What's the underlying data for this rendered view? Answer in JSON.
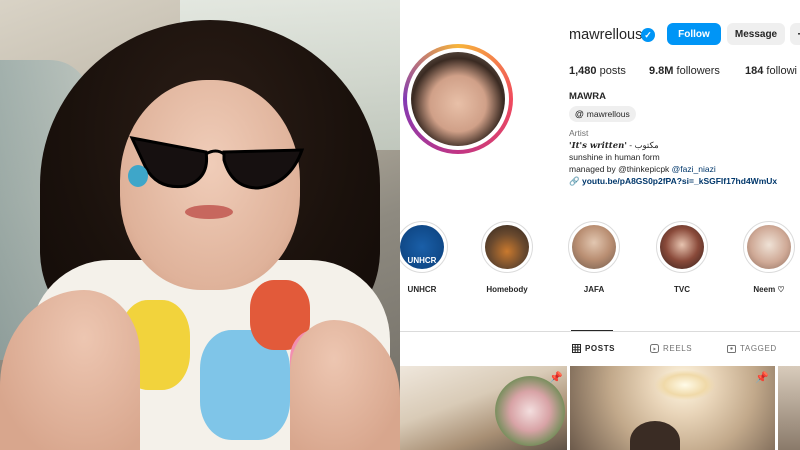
{
  "profile": {
    "username": "mawrellous",
    "follow_label": "Follow",
    "message_label": "Message",
    "more_label": "+",
    "stats": {
      "posts_count": "1,480",
      "posts_label": "posts",
      "followers_count": "9.8M",
      "followers_label": "followers",
      "following_count": "184",
      "following_label": "followi"
    },
    "display_name": "MAWRA",
    "threads_handle": "mawrellous",
    "category": "Artist",
    "bio_line1_italic": "'It's written'",
    "bio_line1_rest": " - مكتوب",
    "bio_line2": "sunshine in human form",
    "bio_line3_text": "managed by @thinkepicpk ",
    "bio_line3_link": "@fazi_niazi",
    "bio_link": "youtu.be/pA8GS0p2fPA?si=_kSGFIf17hd4WmUx"
  },
  "highlights": [
    {
      "label": "UNHCR",
      "inner_text": "UNHCR"
    },
    {
      "label": "Homebody"
    },
    {
      "label": "JAFA"
    },
    {
      "label": "TVC"
    },
    {
      "label": "Neem ♡"
    }
  ],
  "tabs": {
    "posts": "POSTS",
    "reels": "REELS",
    "tagged": "TAGGED"
  },
  "icons": {
    "verified": "✓",
    "pin": "📌"
  },
  "colors": {
    "accent": "#0095f6",
    "link": "#00376b"
  }
}
